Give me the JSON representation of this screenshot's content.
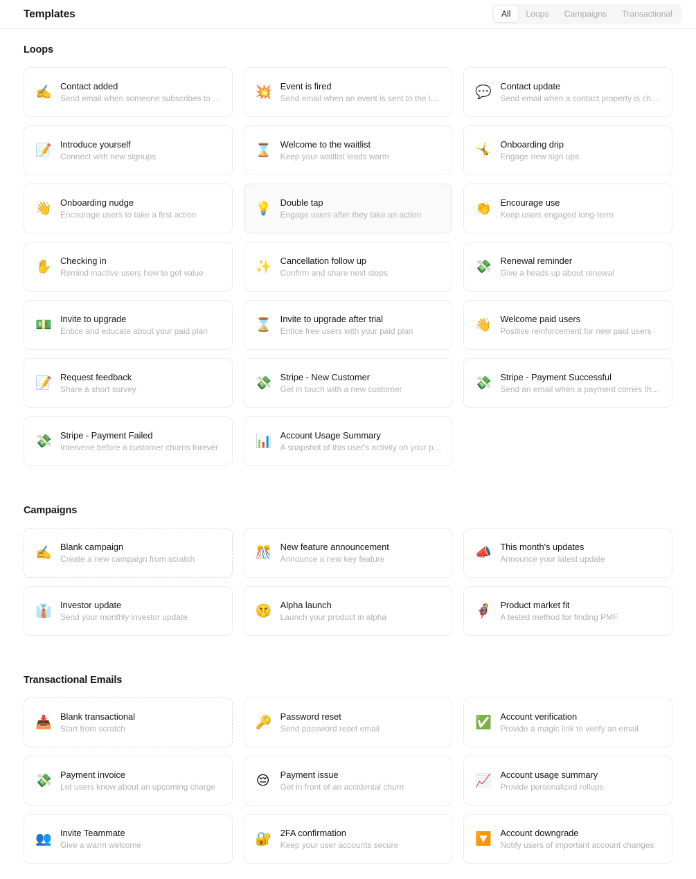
{
  "header": {
    "title": "Templates",
    "filters": [
      {
        "label": "All",
        "active": true
      },
      {
        "label": "Loops",
        "active": false
      },
      {
        "label": "Campaigns",
        "active": false
      },
      {
        "label": "Transactional",
        "active": false
      }
    ]
  },
  "sections": [
    {
      "id": "loops",
      "heading": "Loops",
      "cards": [
        {
          "icon": "writing-hand-emoji",
          "glyph": "✍️",
          "title": "Contact added",
          "desc": "Send email when someone subscribes to a list",
          "dashed": false,
          "hovered": false
        },
        {
          "icon": "collision-emoji",
          "glyph": "💥",
          "title": "Event is fired",
          "desc": "Send email when an event is sent to the loo…",
          "dashed": false,
          "hovered": false
        },
        {
          "icon": "speech-balloon-emoji",
          "glyph": "💬",
          "title": "Contact update",
          "desc": "Send email when a contact property is chan…",
          "dashed": false,
          "hovered": false
        },
        {
          "icon": "memo-emoji",
          "glyph": "📝",
          "title": "Introduce yourself",
          "desc": "Connect with new signups",
          "dashed": false,
          "hovered": false
        },
        {
          "icon": "hourglass-emoji",
          "glyph": "⌛",
          "title": "Welcome to the waitlist",
          "desc": "Keep your waitlist leads warm",
          "dashed": false,
          "hovered": false
        },
        {
          "icon": "cartwheel-emoji",
          "glyph": "🤸",
          "title": "Onboarding drip",
          "desc": "Engage new sign ups",
          "dashed": false,
          "hovered": false
        },
        {
          "icon": "waving-hand-emoji",
          "glyph": "👋",
          "title": "Onboarding nudge",
          "desc": "Encourage users to take a first action",
          "dashed": false,
          "hovered": false
        },
        {
          "icon": "light-bulb-emoji",
          "glyph": "💡",
          "title": "Double tap",
          "desc": "Engage users after they take an action",
          "dashed": false,
          "hovered": true
        },
        {
          "icon": "clapping-hands-emoji",
          "glyph": "👏",
          "title": "Encourage use",
          "desc": "Keep users engaged long-term",
          "dashed": false,
          "hovered": false
        },
        {
          "icon": "raised-hand-emoji",
          "glyph": "✋",
          "title": "Checking in",
          "desc": "Remind inactive users how to get value",
          "dashed": false,
          "hovered": false
        },
        {
          "icon": "sparkles-emoji",
          "glyph": "✨",
          "title": "Cancellation follow up",
          "desc": "Confirm and share next steps",
          "dashed": false,
          "hovered": false
        },
        {
          "icon": "money-with-wings-emoji",
          "glyph": "💸",
          "title": "Renewal reminder",
          "desc": "Give a heads up about renewal",
          "dashed": false,
          "hovered": false
        },
        {
          "icon": "money-banknote-emoji",
          "glyph": "💵",
          "title": "Invite to upgrade",
          "desc": "Entice and educate about your paid plan",
          "dashed": false,
          "hovered": false
        },
        {
          "icon": "hourglass-emoji",
          "glyph": "⌛",
          "title": "Invite to upgrade after trial",
          "desc": "Entice free users with your paid plan",
          "dashed": false,
          "hovered": false
        },
        {
          "icon": "waving-hand-emoji",
          "glyph": "👋",
          "title": "Welcome paid users",
          "desc": "Positive reinforcement for new paid users",
          "dashed": false,
          "hovered": false
        },
        {
          "icon": "memo-emoji",
          "glyph": "📝",
          "title": "Request feedback",
          "desc": "Share a short survey",
          "dashed": false,
          "hovered": false
        },
        {
          "icon": "money-with-wings-emoji",
          "glyph": "💸",
          "title": "Stripe - New Customer",
          "desc": "Get in touch with a new customer",
          "dashed": false,
          "hovered": false
        },
        {
          "icon": "money-with-wings-emoji",
          "glyph": "💸",
          "title": "Stripe - Payment Successful",
          "desc": "Send an email when a payment comes throu…",
          "dashed": false,
          "hovered": false
        },
        {
          "icon": "money-with-wings-emoji",
          "glyph": "💸",
          "title": "Stripe - Payment Failed",
          "desc": "Intervene before a customer churns forever",
          "dashed": false,
          "hovered": false
        },
        {
          "icon": "bar-chart-emoji",
          "glyph": "📊",
          "title": "Account Usage Summary",
          "desc": "A snapshot of this user's activity on your pla…",
          "dashed": false,
          "hovered": false
        }
      ]
    },
    {
      "id": "campaigns",
      "heading": "Campaigns",
      "cards": [
        {
          "icon": "writing-hand-emoji",
          "glyph": "✍️",
          "title": "Blank campaign",
          "desc": "Create a new campaign from scratch",
          "dashed": true,
          "hovered": false
        },
        {
          "icon": "confetti-ball-emoji",
          "glyph": "🎊",
          "title": "New feature announcement",
          "desc": "Announce a new key feature",
          "dashed": false,
          "hovered": false
        },
        {
          "icon": "megaphone-emoji",
          "glyph": "📣",
          "title": "This month's updates",
          "desc": "Announce your latest update",
          "dashed": false,
          "hovered": false
        },
        {
          "icon": "necktie-emoji",
          "glyph": "👔",
          "title": "Investor update",
          "desc": "Send your monthly investor update",
          "dashed": false,
          "hovered": false
        },
        {
          "icon": "shushing-face-emoji",
          "glyph": "🤫",
          "title": "Alpha launch",
          "desc": "Launch your product in alpha",
          "dashed": false,
          "hovered": false
        },
        {
          "icon": "superhero-emoji",
          "glyph": "🦸",
          "title": "Product market fit",
          "desc": "A tested method for finding PMF",
          "dashed": false,
          "hovered": false
        }
      ]
    },
    {
      "id": "transactional",
      "heading": "Transactional Emails",
      "cards": [
        {
          "icon": "inbox-tray-emoji",
          "glyph": "📥",
          "title": "Blank transactional",
          "desc": "Start from scratch",
          "dashed": true,
          "hovered": false
        },
        {
          "icon": "key-emoji",
          "glyph": "🔑",
          "title": "Password reset",
          "desc": "Send password reset email",
          "dashed": false,
          "hovered": false
        },
        {
          "icon": "check-mark-button-emoji",
          "glyph": "✅",
          "title": "Account verification",
          "desc": "Provide a magic link to verify an email",
          "dashed": false,
          "hovered": false
        },
        {
          "icon": "money-with-wings-emoji",
          "glyph": "💸",
          "title": "Payment invoice",
          "desc": "Let users know about an upcoming charge",
          "dashed": false,
          "hovered": false
        },
        {
          "icon": "pensive-face-emoji",
          "glyph": "😔",
          "title": "Payment issue",
          "desc": "Get in front of an accidental churn",
          "dashed": false,
          "hovered": false
        },
        {
          "icon": "chart-increasing-emoji",
          "glyph": "📈",
          "title": "Account usage summary",
          "desc": "Provide personalized rollups",
          "dashed": false,
          "hovered": false
        },
        {
          "icon": "busts-in-silhouette-emoji",
          "glyph": "👥",
          "title": "Invite Teammate",
          "desc": "Give a warm welcome",
          "dashed": false,
          "hovered": false
        },
        {
          "icon": "locked-with-key-emoji",
          "glyph": "🔐",
          "title": "2FA confirmation",
          "desc": "Keep your user accounts secure",
          "dashed": false,
          "hovered": false
        },
        {
          "icon": "down-button-emoji",
          "glyph": "🔽",
          "title": "Account downgrade",
          "desc": "Notify users of important account changes",
          "dashed": false,
          "hovered": false
        }
      ]
    }
  ]
}
